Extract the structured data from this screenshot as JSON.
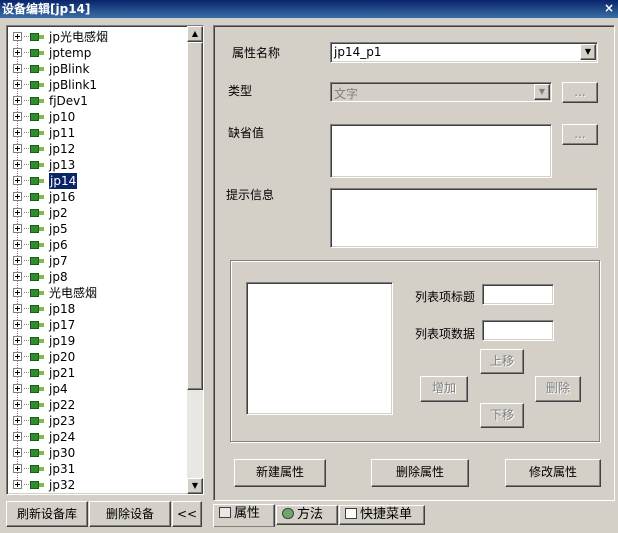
{
  "window": {
    "title": "设备编辑[jp14]",
    "close": "×"
  },
  "tree": {
    "items": [
      {
        "label": "jp光电感烟"
      },
      {
        "label": "jptemp"
      },
      {
        "label": "jpBlink"
      },
      {
        "label": "jpBlink1"
      },
      {
        "label": "fjDev1"
      },
      {
        "label": "jp10"
      },
      {
        "label": "jp11"
      },
      {
        "label": "jp12"
      },
      {
        "label": "jp13"
      },
      {
        "label": "jp14",
        "selected": true
      },
      {
        "label": "jp16"
      },
      {
        "label": "jp2"
      },
      {
        "label": "jp5"
      },
      {
        "label": "jp6"
      },
      {
        "label": "jp7"
      },
      {
        "label": "jp8"
      },
      {
        "label": "光电感烟"
      },
      {
        "label": "jp18"
      },
      {
        "label": "jp17"
      },
      {
        "label": "jp19"
      },
      {
        "label": "jp20"
      },
      {
        "label": "jp21"
      },
      {
        "label": "jp4"
      },
      {
        "label": "jp22"
      },
      {
        "label": "jp23"
      },
      {
        "label": "jp24"
      },
      {
        "label": "jp30"
      },
      {
        "label": "jp31"
      },
      {
        "label": "jp32"
      }
    ]
  },
  "left_buttons": {
    "refresh": "刷新设备库",
    "delete": "删除设备",
    "collapse": "<<"
  },
  "form": {
    "attr_name_label": "属性名称",
    "attr_name_value": "jp14_p1",
    "type_label": "类型",
    "type_value": "文字",
    "default_label": "缺省值",
    "hint_label": "提示信息",
    "ellipsis": "...",
    "list_title_label": "列表项标题",
    "list_data_label": "列表项数据",
    "up": "上移",
    "down": "下移",
    "add": "增加",
    "remove": "删除"
  },
  "bottom_buttons": {
    "new": "新建属性",
    "delete": "删除属性",
    "modify": "修改属性"
  },
  "tabs": [
    {
      "label": "属性",
      "icon": "properties-icon",
      "active": true
    },
    {
      "label": "方法",
      "icon": "method-icon",
      "active": false
    },
    {
      "label": "快捷菜单",
      "icon": "menu-icon",
      "active": false
    }
  ]
}
